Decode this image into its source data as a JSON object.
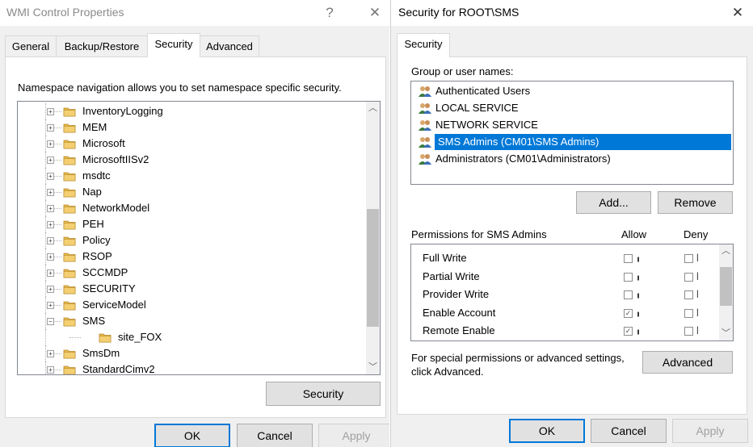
{
  "left_window": {
    "title": "WMI Control Properties",
    "help_glyph": "?",
    "close_glyph": "✕",
    "tabs": [
      {
        "label": "General",
        "selected": false
      },
      {
        "label": "Backup/Restore",
        "selected": false
      },
      {
        "label": "Security",
        "selected": true
      },
      {
        "label": "Advanced",
        "selected": false
      }
    ],
    "description": "Namespace navigation allows you to set namespace specific security.",
    "tree_items": [
      {
        "label": "InventoryLogging",
        "expander": "+",
        "child": false
      },
      {
        "label": "MEM",
        "expander": "+",
        "child": false
      },
      {
        "label": "Microsoft",
        "expander": "+",
        "child": false
      },
      {
        "label": "MicrosoftIISv2",
        "expander": "+",
        "child": false
      },
      {
        "label": "msdtc",
        "expander": "+",
        "child": false
      },
      {
        "label": "Nap",
        "expander": "+",
        "child": false
      },
      {
        "label": "NetworkModel",
        "expander": "+",
        "child": false
      },
      {
        "label": "PEH",
        "expander": "+",
        "child": false
      },
      {
        "label": "Policy",
        "expander": "+",
        "child": false
      },
      {
        "label": "RSOP",
        "expander": "+",
        "child": false
      },
      {
        "label": "SCCMDP",
        "expander": "+",
        "child": false
      },
      {
        "label": "SECURITY",
        "expander": "+",
        "child": false
      },
      {
        "label": "ServiceModel",
        "expander": "+",
        "child": false
      },
      {
        "label": "SMS",
        "expander": "−",
        "child": false
      },
      {
        "label": "site_FOX",
        "expander": "",
        "child": true
      },
      {
        "label": "SmsDm",
        "expander": "+",
        "child": false
      },
      {
        "label": "StandardCimv2",
        "expander": "+",
        "child": false
      }
    ],
    "security_button": "Security",
    "ok_button": "OK",
    "cancel_button": "Cancel",
    "apply_button": "Apply"
  },
  "right_window": {
    "title": "Security for ROOT\\SMS",
    "close_glyph": "✕",
    "tab": "Security",
    "group_label": "Group or user names:",
    "users": [
      {
        "label": "Authenticated Users",
        "selected": false
      },
      {
        "label": "LOCAL SERVICE",
        "selected": false
      },
      {
        "label": "NETWORK SERVICE",
        "selected": false
      },
      {
        "label": "SMS Admins (CM01\\SMS Admins)",
        "selected": true
      },
      {
        "label": "Administrators (CM01\\Administrators)",
        "selected": false
      }
    ],
    "add_button": "Add...",
    "remove_button": "Remove",
    "permissions_label": "Permissions for SMS Admins",
    "allow_header": "Allow",
    "deny_header": "Deny",
    "permissions": [
      {
        "label": "Full Write",
        "allow": false,
        "deny": false
      },
      {
        "label": "Partial Write",
        "allow": false,
        "deny": false
      },
      {
        "label": "Provider Write",
        "allow": false,
        "deny": false
      },
      {
        "label": "Enable Account",
        "allow": true,
        "deny": false
      },
      {
        "label": "Remote Enable",
        "allow": true,
        "deny": false
      }
    ],
    "special_text_line1": "For special permissions or advanced settings,",
    "special_text_line2": "click Advanced.",
    "advanced_button": "Advanced",
    "ok_button": "OK",
    "cancel_button": "Cancel",
    "apply_button": "Apply"
  },
  "colors": {
    "selection": "#0078d7",
    "folder": "#e8b84a",
    "dialog_bg": "#f0f0f0"
  }
}
